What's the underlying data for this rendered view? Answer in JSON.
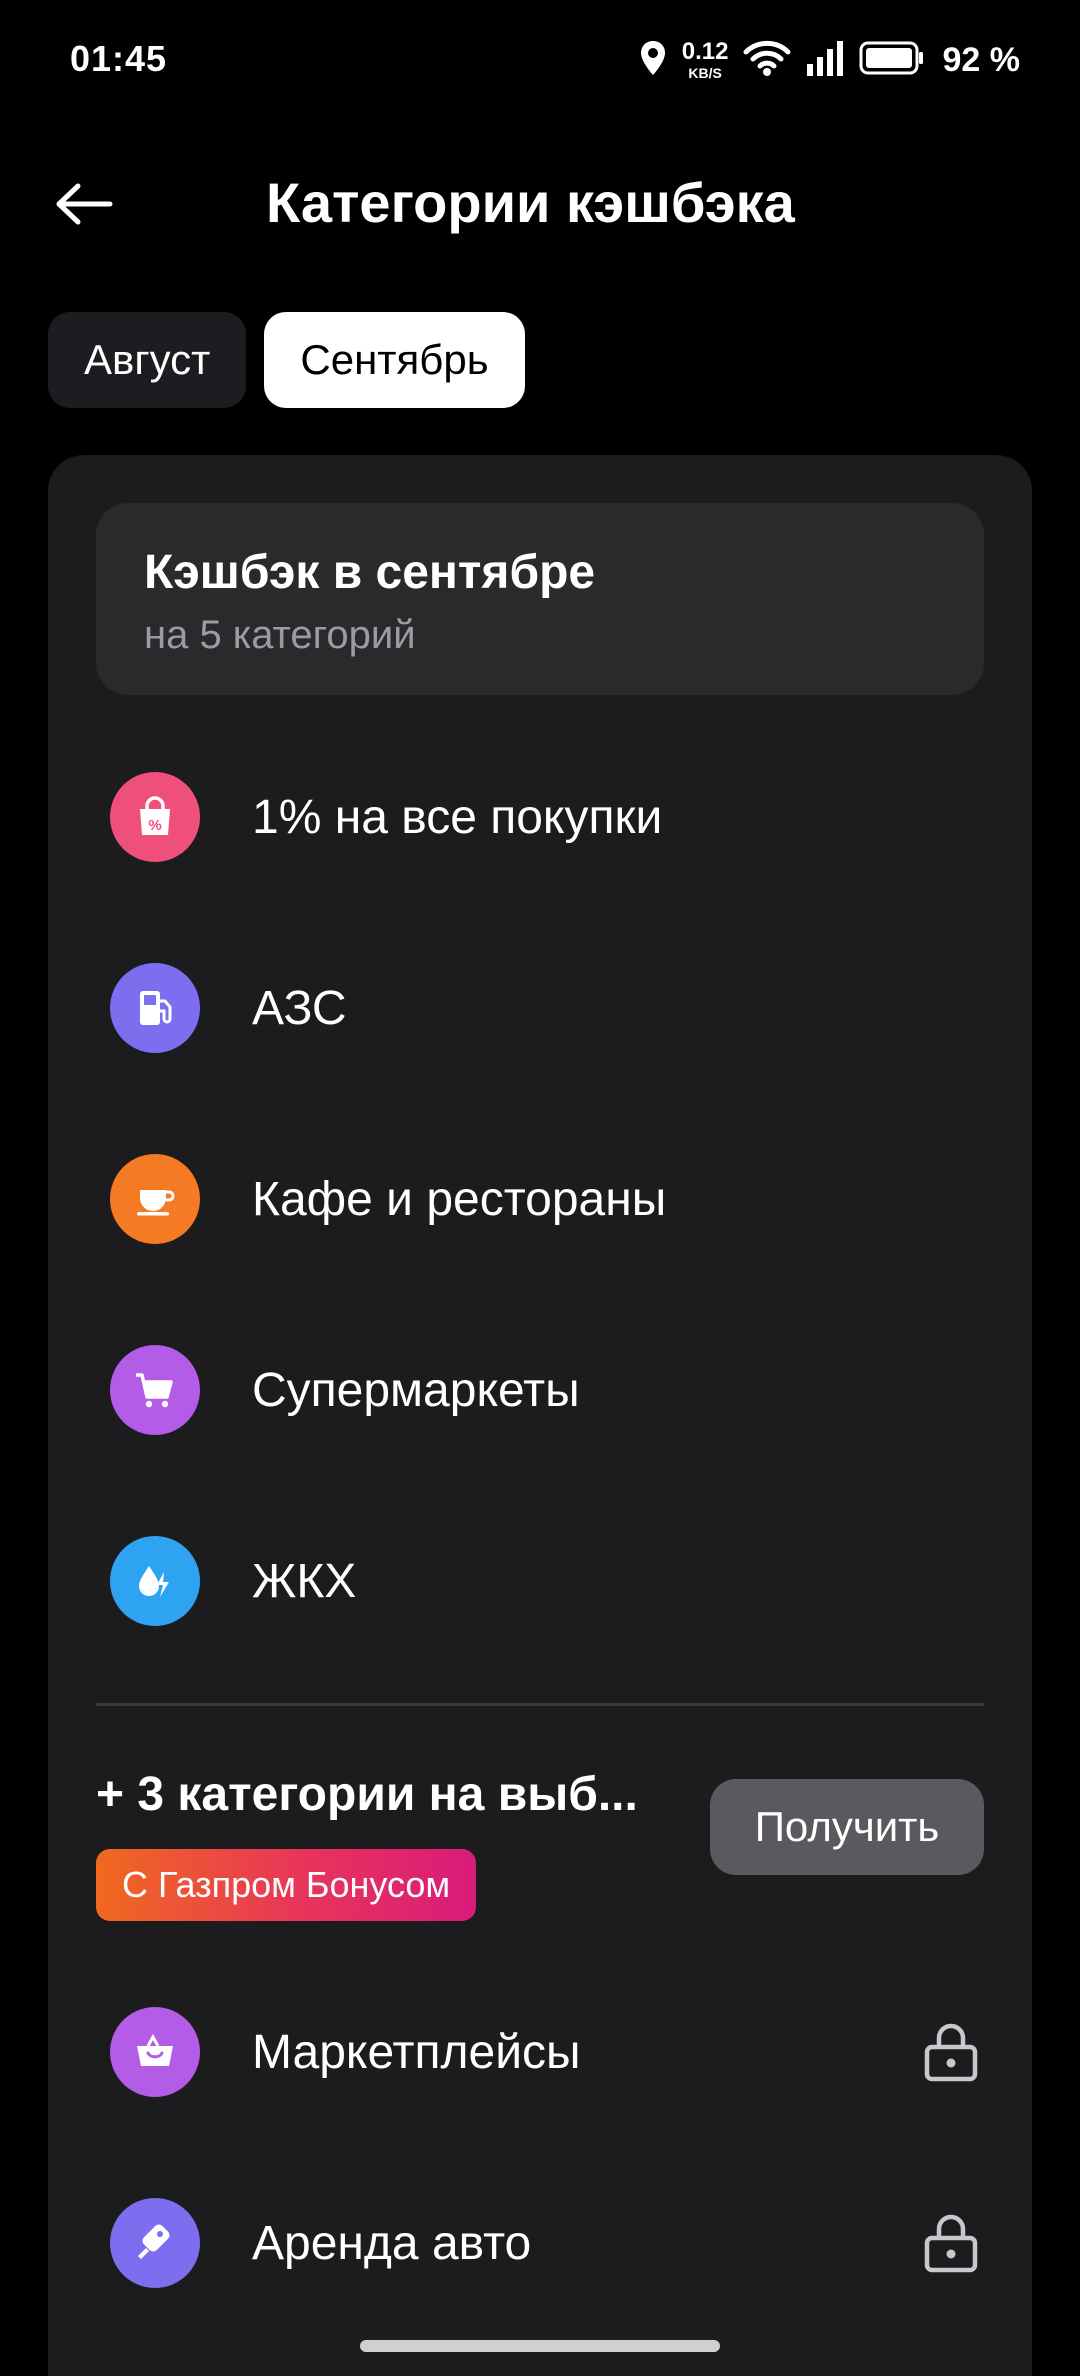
{
  "status_bar": {
    "time": "01:45",
    "net_speed_value": "0.12",
    "net_speed_unit": "KB/S",
    "battery_percent": "92 %",
    "icons": [
      "location-icon",
      "wifi-icon",
      "signal-icon",
      "battery-icon"
    ]
  },
  "header": {
    "title": "Категории кэшбэка",
    "back_icon": "arrow-left-icon"
  },
  "tabs": [
    {
      "label": "Август",
      "selected": false
    },
    {
      "label": "Сентябрь",
      "selected": true
    }
  ],
  "summary": {
    "title": "Кэшбэк в сентябре",
    "subtitle": "на 5 категорий"
  },
  "categories": [
    {
      "label": "1% на все покупки",
      "icon": "shopping-bag-percent-icon",
      "color": "#ee4f7b"
    },
    {
      "label": "АЗС",
      "icon": "fuel-pump-icon",
      "color": "#7d6ef0"
    },
    {
      "label": "Кафе и рестораны",
      "icon": "coffee-cup-icon",
      "color": "#f47a24"
    },
    {
      "label": "Супермаркеты",
      "icon": "shopping-cart-icon",
      "color": "#b25ce8"
    },
    {
      "label": "ЖКХ",
      "icon": "utilities-drop-bolt-icon",
      "color": "#2ea3f2"
    }
  ],
  "extra": {
    "title": "+ 3 категории на выб...",
    "badge": "С Газпром Бонусом",
    "button": "Получить"
  },
  "locked_categories": [
    {
      "label": "Маркетплейсы",
      "icon": "basket-icon",
      "color": "#b25ce8",
      "locked": true
    },
    {
      "label": "Аренда авто",
      "icon": "car-key-icon",
      "color": "#7d6ef0",
      "locked": true
    }
  ]
}
